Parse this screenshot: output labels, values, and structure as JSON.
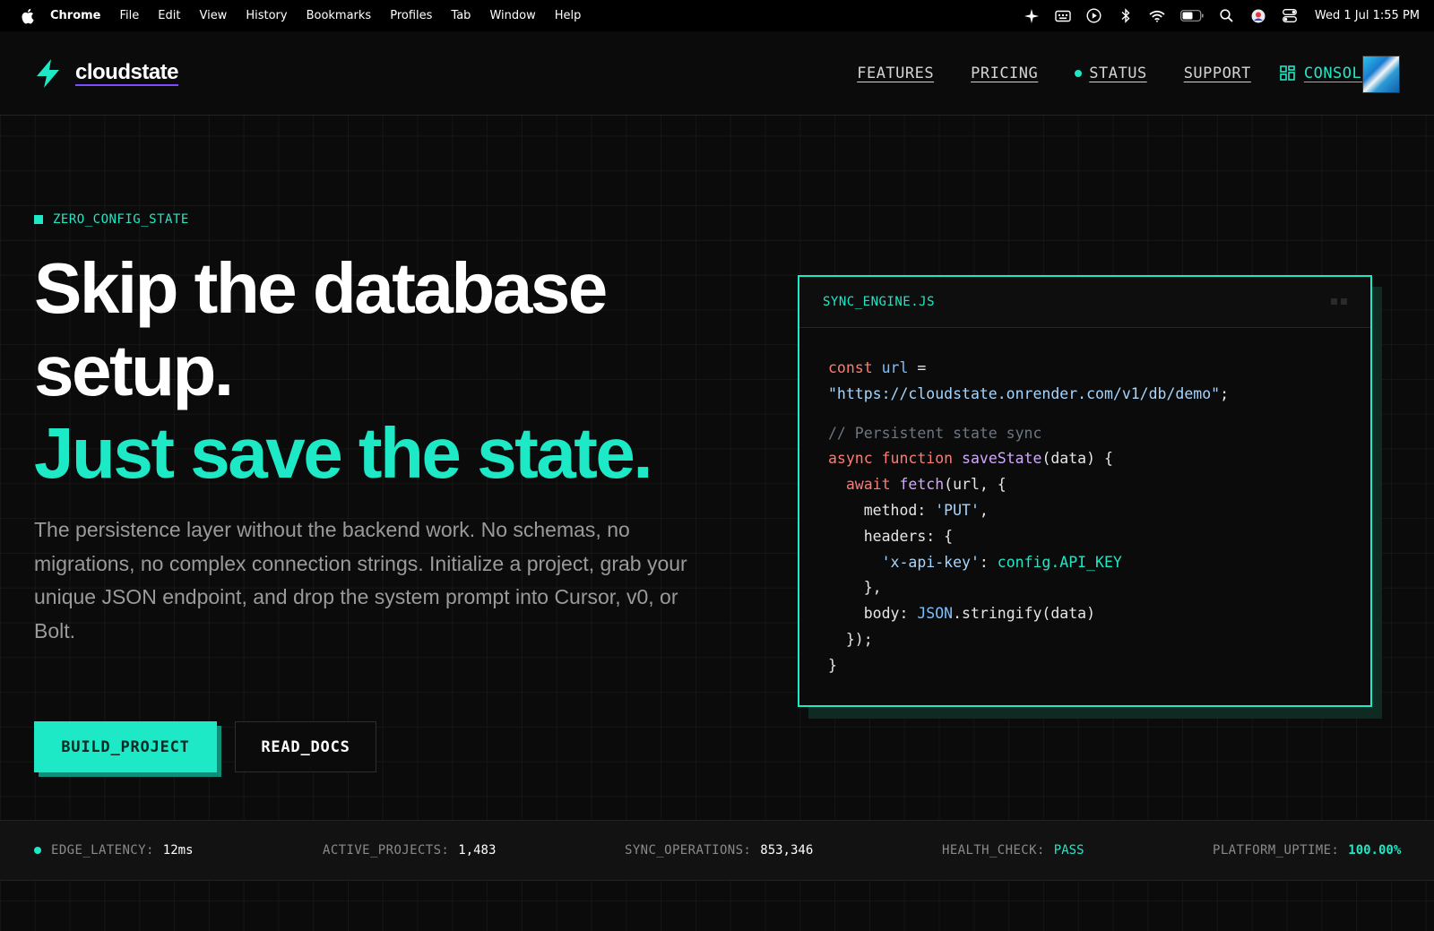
{
  "menubar": {
    "app": "Chrome",
    "items": [
      "File",
      "Edit",
      "View",
      "History",
      "Bookmarks",
      "Profiles",
      "Tab",
      "Window",
      "Help"
    ],
    "clock": "Wed 1 Jul  1:55 PM"
  },
  "header": {
    "brand": "cloudstate",
    "nav": {
      "features": "FEATURES",
      "pricing": "PRICING",
      "status": "STATUS",
      "support": "SUPPORT",
      "console": "CONSOLE"
    }
  },
  "hero": {
    "tag": "ZERO_CONFIG_STATE",
    "headline_line1": "Skip the database",
    "headline_line2": "setup.",
    "headline_line3": "Just save the state.",
    "lede": "The persistence layer without the backend work. No schemas, no migrations, no complex connection strings. Initialize a project, grab your unique JSON endpoint, and drop the system prompt into Cursor, v0, or Bolt.",
    "primary_button": "BUILD_PROJECT",
    "secondary_button": "READ_DOCS"
  },
  "code": {
    "filename": "SYNC_ENGINE.JS"
  },
  "stats": {
    "latency_label": "EDGE_LATENCY:",
    "latency_value": "12ms",
    "projects_label": "ACTIVE_PROJECTS:",
    "projects_value": "1,483",
    "sync_label": "SYNC_OPERATIONS:",
    "sync_value": "853,346",
    "health_label": "HEALTH_CHECK:",
    "health_value": "PASS",
    "uptime_label": "PLATFORM_UPTIME:",
    "uptime_value": "100.00%"
  },
  "colors": {
    "accent": "#1de9c6",
    "background": "#0b0b0b",
    "brand_underline": "#7c4dff"
  }
}
